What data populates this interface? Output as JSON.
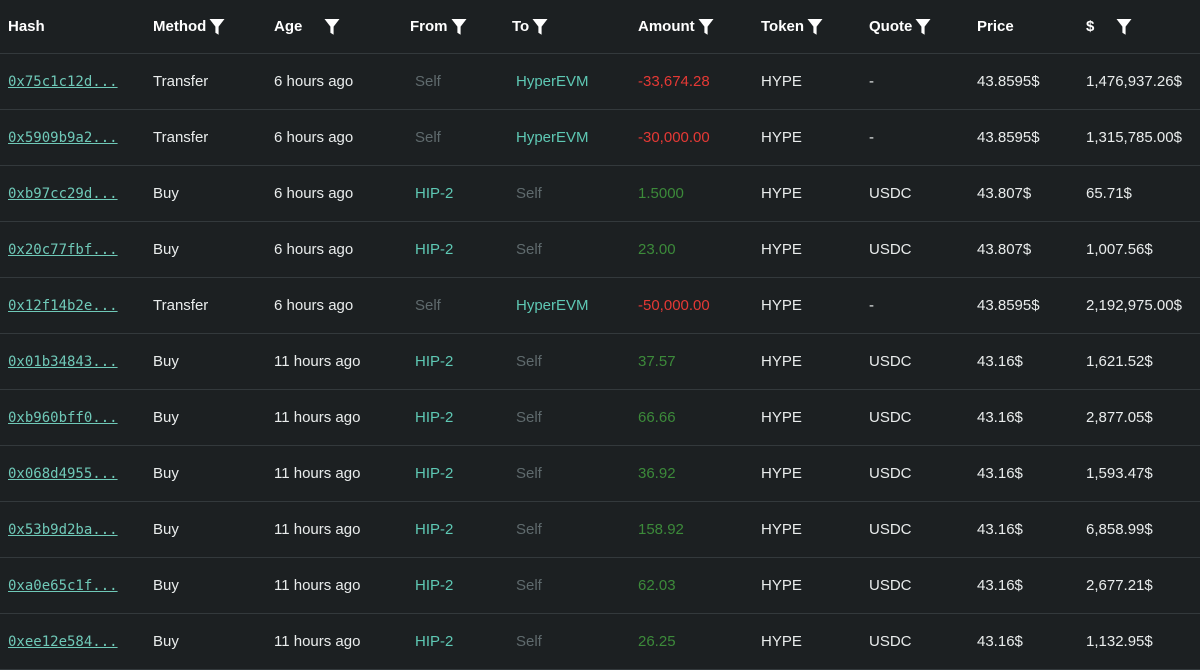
{
  "colors": {
    "background": "#1c2022",
    "link": "#6fc9b8",
    "address": "#5ec8b4",
    "self": "#5f6a6d",
    "negative": "#e53935",
    "positive": "#3c8a3a"
  },
  "header": {
    "hash": "Hash",
    "method": "Method",
    "age": "Age",
    "from": "From",
    "to": "To",
    "amount": "Amount",
    "token": "Token",
    "quote": "Quote",
    "price": "Price",
    "usd": "$"
  },
  "filter_icon": "filter-icon",
  "rows": [
    {
      "hash": "0x75c1c12d...",
      "method": "Transfer",
      "age": "6 hours ago",
      "from": "Self",
      "to": "HyperEVM",
      "amount": "-33,674.28",
      "amount_sign": "negative",
      "token": "HYPE",
      "quote": "-",
      "price": "43.8595$",
      "usd": "1,476,937.26$"
    },
    {
      "hash": "0x5909b9a2...",
      "method": "Transfer",
      "age": "6 hours ago",
      "from": "Self",
      "to": "HyperEVM",
      "amount": "-30,000.00",
      "amount_sign": "negative",
      "token": "HYPE",
      "quote": "-",
      "price": "43.8595$",
      "usd": "1,315,785.00$"
    },
    {
      "hash": "0xb97cc29d...",
      "method": "Buy",
      "age": "6 hours ago",
      "from": "HIP-2",
      "to": "Self",
      "amount": "1.5000",
      "amount_sign": "positive",
      "token": "HYPE",
      "quote": "USDC",
      "price": "43.807$",
      "usd": "65.71$"
    },
    {
      "hash": "0x20c77fbf...",
      "method": "Buy",
      "age": "6 hours ago",
      "from": "HIP-2",
      "to": "Self",
      "amount": "23.00",
      "amount_sign": "positive",
      "token": "HYPE",
      "quote": "USDC",
      "price": "43.807$",
      "usd": "1,007.56$"
    },
    {
      "hash": "0x12f14b2e...",
      "method": "Transfer",
      "age": "6 hours ago",
      "from": "Self",
      "to": "HyperEVM",
      "amount": "-50,000.00",
      "amount_sign": "negative",
      "token": "HYPE",
      "quote": "-",
      "price": "43.8595$",
      "usd": "2,192,975.00$"
    },
    {
      "hash": "0x01b34843...",
      "method": "Buy",
      "age": "11 hours ago",
      "from": "HIP-2",
      "to": "Self",
      "amount": "37.57",
      "amount_sign": "positive",
      "token": "HYPE",
      "quote": "USDC",
      "price": "43.16$",
      "usd": "1,621.52$"
    },
    {
      "hash": "0xb960bff0...",
      "method": "Buy",
      "age": "11 hours ago",
      "from": "HIP-2",
      "to": "Self",
      "amount": "66.66",
      "amount_sign": "positive",
      "token": "HYPE",
      "quote": "USDC",
      "price": "43.16$",
      "usd": "2,877.05$"
    },
    {
      "hash": "0x068d4955...",
      "method": "Buy",
      "age": "11 hours ago",
      "from": "HIP-2",
      "to": "Self",
      "amount": "36.92",
      "amount_sign": "positive",
      "token": "HYPE",
      "quote": "USDC",
      "price": "43.16$",
      "usd": "1,593.47$"
    },
    {
      "hash": "0x53b9d2ba...",
      "method": "Buy",
      "age": "11 hours ago",
      "from": "HIP-2",
      "to": "Self",
      "amount": "158.92",
      "amount_sign": "positive",
      "token": "HYPE",
      "quote": "USDC",
      "price": "43.16$",
      "usd": "6,858.99$"
    },
    {
      "hash": "0xa0e65c1f...",
      "method": "Buy",
      "age": "11 hours ago",
      "from": "HIP-2",
      "to": "Self",
      "amount": "62.03",
      "amount_sign": "positive",
      "token": "HYPE",
      "quote": "USDC",
      "price": "43.16$",
      "usd": "2,677.21$"
    },
    {
      "hash": "0xee12e584...",
      "method": "Buy",
      "age": "11 hours ago",
      "from": "HIP-2",
      "to": "Self",
      "amount": "26.25",
      "amount_sign": "positive",
      "token": "HYPE",
      "quote": "USDC",
      "price": "43.16$",
      "usd": "1,132.95$"
    }
  ]
}
